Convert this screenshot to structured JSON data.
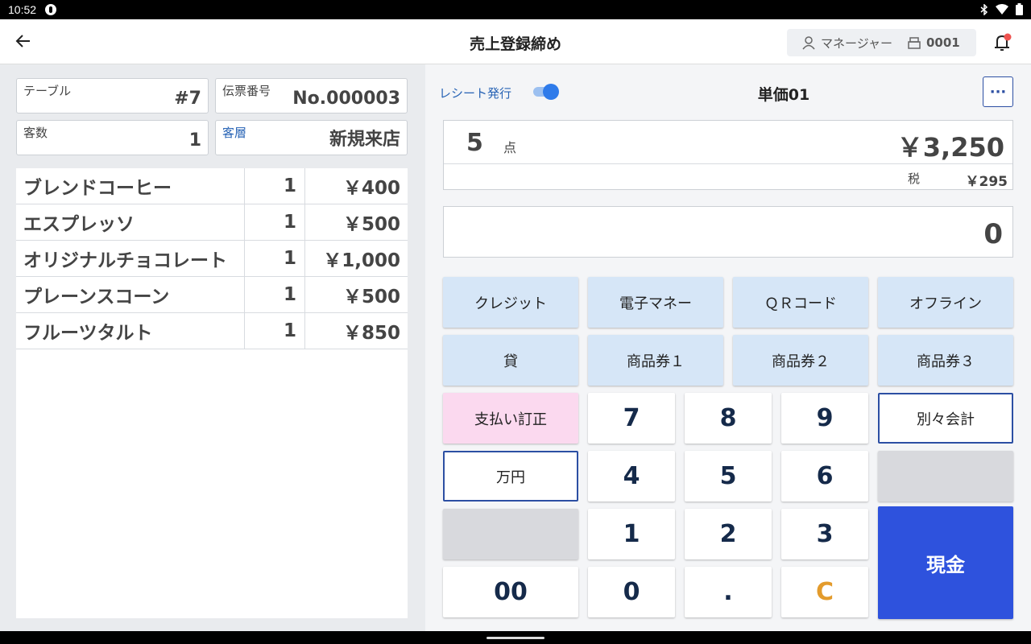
{
  "status_bar": {
    "time": "10:52",
    "icons": [
      "notification-icon",
      "bluetooth-icon",
      "wifi-icon",
      "battery-icon"
    ]
  },
  "app_bar": {
    "title": "売上登録締め",
    "user_name": "マネージャー",
    "register_number": "0001",
    "icons": [
      "back-arrow-icon",
      "user-icon",
      "register-icon",
      "bell-icon"
    ],
    "bell_badge_color": "#ef5350"
  },
  "order_info": {
    "table_label": "テーブル",
    "table_value": "#7",
    "slip_label": "伝票番号",
    "slip_value": "No.000003",
    "guests_label": "客数",
    "guests_value": "1",
    "customer_type_label": "客層",
    "customer_type_value": "新規来店"
  },
  "items": [
    {
      "name": "ブレンドコーヒー",
      "qty": "1",
      "price": "￥400"
    },
    {
      "name": "エスプレッソ",
      "qty": "1",
      "price": "￥500"
    },
    {
      "name": "オリジナルチョコレート",
      "qty": "1",
      "price": "￥1,000"
    },
    {
      "name": "プレーンスコーン",
      "qty": "1",
      "price": "￥500"
    },
    {
      "name": "フルーツタルト",
      "qty": "1",
      "price": "￥850"
    }
  ],
  "receipt": {
    "label": "レシート発行",
    "enabled": true
  },
  "price_mode": "単価01",
  "more_label": "···",
  "totals": {
    "count": "5",
    "count_unit": "点",
    "amount": "￥3,250",
    "tax_label": "税",
    "tax_amount": "￥295"
  },
  "input_value": "0",
  "payment_methods": {
    "credit": "クレジット",
    "emoney": "電子マネー",
    "qr": "ＱＲコード",
    "offline": "オフライン",
    "credit_sale": "貸",
    "voucher1": "商品券１",
    "voucher2": "商品券２",
    "voucher3": "商品券３"
  },
  "keypad": {
    "correction": "支払い訂正",
    "separate": "別々会計",
    "man_yen": "万円",
    "k7": "7",
    "k8": "8",
    "k9": "9",
    "k4": "4",
    "k5": "5",
    "k6": "6",
    "k1": "1",
    "k2": "2",
    "k3": "3",
    "k00": "00",
    "k0": "0",
    "kdot": ".",
    "kclear": "C",
    "cash": "現金"
  },
  "colors": {
    "accent": "#2e52dd",
    "outline": "#2c4fa3",
    "pay_key": "#d6e6f7",
    "correction_key": "#fbd9ef",
    "clear_key_text": "#e39b2c",
    "label_blue": "#2763b5"
  }
}
